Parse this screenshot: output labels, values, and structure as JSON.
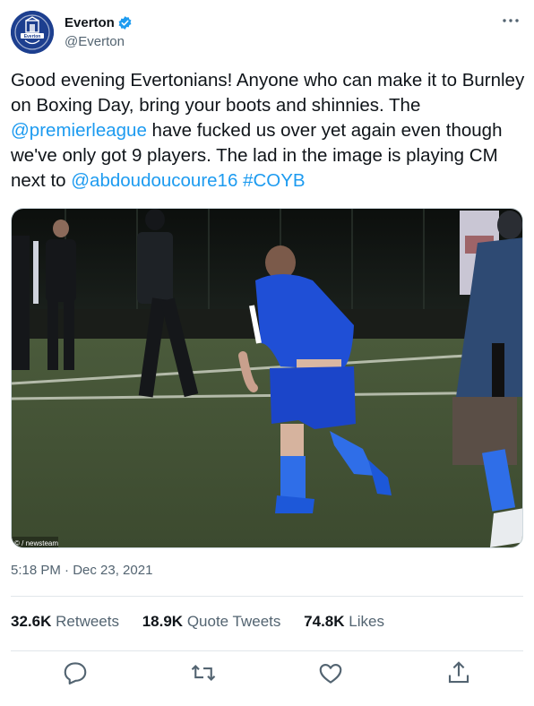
{
  "account": {
    "display_name": "Everton",
    "handle": "@Everton",
    "verified_icon": "verified-badge-icon",
    "avatar_text": "Everton",
    "brand_color": "#1d3f8f"
  },
  "tweet": {
    "text_1": "Good evening Evertonians! Anyone who can make it to Burnley on Boxing Day, bring your boots and shinnies. The ",
    "mention_1": "@premierleague",
    "text_2": " have fucked us over yet again even though we've only got 9 players. The lad in the image is playing CM next to ",
    "mention_2": "@abdoudoucoure16",
    "text_3": " ",
    "hashtag": "#COYB",
    "link_color": "#1d9bf0"
  },
  "media": {
    "watermark": "© / newsteam"
  },
  "timestamp": "5:18 PM · Dec 23, 2021",
  "stats": [
    {
      "count": "32.6K",
      "label": "Retweets"
    },
    {
      "count": "18.9K",
      "label": "Quote Tweets"
    },
    {
      "count": "74.8K",
      "label": "Likes"
    }
  ],
  "actions": [
    "reply-icon",
    "retweet-icon",
    "like-icon",
    "share-icon"
  ]
}
